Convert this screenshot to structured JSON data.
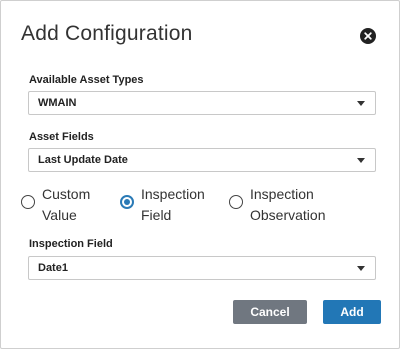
{
  "dialog": {
    "title": "Add Configuration",
    "close_icon": "close-circle-icon"
  },
  "fields": {
    "asset_types": {
      "label": "Available Asset Types",
      "value": "WMAIN"
    },
    "asset_fields": {
      "label": "Asset Fields",
      "value": "Last Update Date"
    },
    "inspection_field": {
      "label": "Inspection Field",
      "value": "Date1"
    }
  },
  "radio_options": [
    {
      "line1": "Custom",
      "line2": "Value",
      "checked": false
    },
    {
      "line1": "Inspection",
      "line2": "Field",
      "checked": true
    },
    {
      "line1": "Inspection",
      "line2": "Observation",
      "checked": false
    }
  ],
  "buttons": {
    "cancel": "Cancel",
    "add": "Add"
  },
  "colors": {
    "primary": "#2277b6",
    "secondary": "#707780",
    "radio_selected": "#2a7ab6"
  }
}
